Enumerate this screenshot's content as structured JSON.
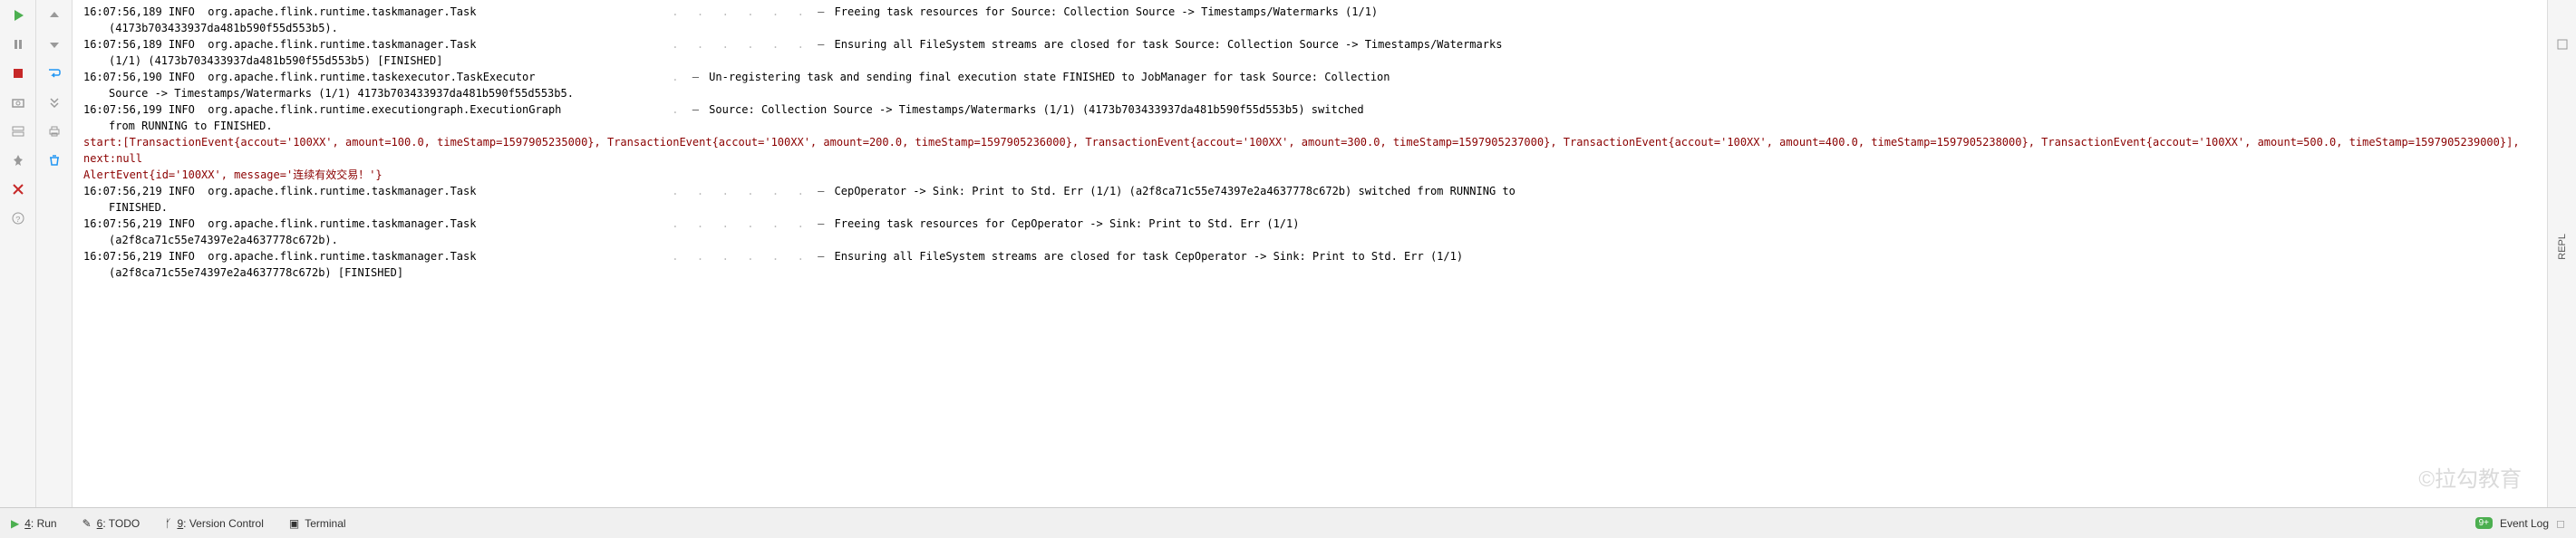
{
  "console": {
    "lines": [
      {
        "type": "info",
        "left": "16:07:56,189 INFO  org.apache.flink.runtime.taskmanager.Task",
        "right": "Freeing task resources for Source: Collection Source -> Timestamps/Watermarks (1/1)",
        "cont": "(4173b703433937da481b590f55d553b5)."
      },
      {
        "type": "info",
        "left": "16:07:56,189 INFO  org.apache.flink.runtime.taskmanager.Task",
        "right": "Ensuring all FileSystem streams are closed for task Source: Collection Source -> Timestamps/Watermarks",
        "cont": "(1/1) (4173b703433937da481b590f55d553b5) [FINISHED]"
      },
      {
        "type": "info",
        "left": "16:07:56,190 INFO  org.apache.flink.runtime.taskexecutor.TaskExecutor",
        "right": "Un-registering task and sending final execution state FINISHED to JobManager for task Source: Collection",
        "cont": "Source -> Timestamps/Watermarks (1/1) 4173b703433937da481b590f55d553b5."
      },
      {
        "type": "info",
        "left": "16:07:56,199 INFO  org.apache.flink.runtime.executiongraph.ExecutionGraph",
        "right": "Source: Collection Source -> Timestamps/Watermarks (1/1) (4173b703433937da481b590f55d553b5) switched",
        "cont": "from RUNNING to FINISHED."
      },
      {
        "type": "red",
        "text": "start:[TransactionEvent{accout='100XX', amount=100.0, timeStamp=1597905235000}, TransactionEvent{accout='100XX', amount=200.0, timeStamp=1597905236000}, TransactionEvent{accout='100XX', amount=300.0, timeStamp=1597905237000}, TransactionEvent{accout='100XX', amount=400.0, timeStamp=1597905238000}, TransactionEvent{accout='100XX', amount=500.0, timeStamp=1597905239000}], next:null"
      },
      {
        "type": "red",
        "text": "AlertEvent{id='100XX', message='连续有效交易！'}"
      },
      {
        "type": "info",
        "left": "16:07:56,219 INFO  org.apache.flink.runtime.taskmanager.Task",
        "right": "CepOperator -> Sink: Print to Std. Err (1/1) (a2f8ca71c55e74397e2a4637778c672b) switched from RUNNING to",
        "cont": "FINISHED."
      },
      {
        "type": "info",
        "left": "16:07:56,219 INFO  org.apache.flink.runtime.taskmanager.Task",
        "right": "Freeing task resources for CepOperator -> Sink: Print to Std. Err (1/1)",
        "cont": "(a2f8ca71c55e74397e2a4637778c672b)."
      },
      {
        "type": "info",
        "left": "16:07:56,219 INFO  org.apache.flink.runtime.taskmanager.Task",
        "right": "Ensuring all FileSystem streams are closed for task CepOperator -> Sink: Print to Std. Err (1/1)",
        "cont": "(a2f8ca71c55e74397e2a4637778c672b) [FINISHED]"
      }
    ]
  },
  "footer": {
    "run": {
      "num": "4",
      "label": ": Run"
    },
    "todo": {
      "num": "6",
      "label": ": TODO"
    },
    "vcs": {
      "num": "9",
      "label": ": Version Control"
    },
    "terminal": {
      "label": "Terminal"
    },
    "event_log_badge": "9+",
    "event_log": "Event Log"
  },
  "rail": {
    "repl": "REPL"
  },
  "watermark": "©拉勾教育"
}
